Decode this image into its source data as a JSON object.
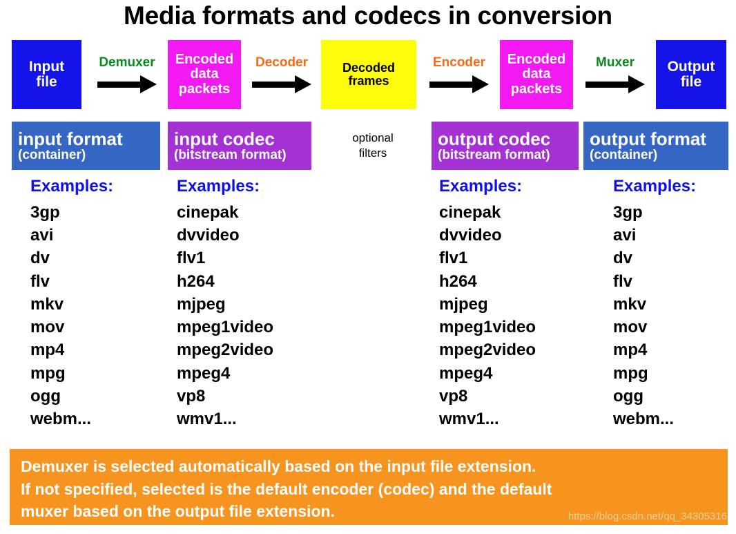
{
  "title": "Media formats and codecs in conversion",
  "pipeline": {
    "boxes": [
      {
        "name": "input-file",
        "lines": [
          "Input",
          "file"
        ],
        "color": "#1414ea"
      },
      {
        "name": "encoded-data-1",
        "lines": [
          "Encoded",
          "data",
          "packets"
        ],
        "color": "#f219f2"
      },
      {
        "name": "decoded-frames",
        "lines": [
          "Decoded",
          "frames"
        ],
        "color": "#fdfd07"
      },
      {
        "name": "encoded-data-2",
        "lines": [
          "Encoded",
          "data",
          "packets"
        ],
        "color": "#f219f2"
      },
      {
        "name": "output-file",
        "lines": [
          "Output",
          "file"
        ],
        "color": "#1414ea"
      }
    ],
    "arrows": [
      {
        "name": "demuxer",
        "label": "Demuxer",
        "color": "#0a8a1e"
      },
      {
        "name": "decoder",
        "label": "Decoder",
        "color": "#f96b16"
      },
      {
        "name": "encoder",
        "label": "Encoder",
        "color": "#f96b16"
      },
      {
        "name": "muxer",
        "label": "Muxer",
        "color": "#0a8a1e"
      }
    ]
  },
  "headers": {
    "input_format": {
      "main": "input format",
      "sub": "(container)",
      "color": "#3566c4"
    },
    "input_codec": {
      "main": "input codec",
      "sub": "(bitstream format)",
      "color": "#a331d3"
    },
    "output_codec": {
      "main": "output codec",
      "sub": "(bitstream format)",
      "color": "#a331d3"
    },
    "output_format": {
      "main": "output format",
      "sub": "(container)",
      "color": "#3566c4"
    }
  },
  "optional_filters": {
    "line1": "optional",
    "line2": "filters"
  },
  "columns": {
    "examples_label": "Examples:",
    "input_format": [
      "3gp",
      "avi",
      "dv",
      "flv",
      "mkv",
      "mov",
      "mp4",
      "mpg",
      "ogg",
      "webm..."
    ],
    "input_codec": [
      "cinepak",
      "dvvideo",
      "flv1",
      "h264",
      "mjpeg",
      "mpeg1video",
      "mpeg2video",
      "mpeg4",
      "vp8",
      "wmv1..."
    ],
    "output_codec": [
      "cinepak",
      "dvvideo",
      "flv1",
      "h264",
      "mjpeg",
      "mpeg1video",
      "mpeg2video",
      "mpeg4",
      "vp8",
      "wmv1..."
    ],
    "output_format": [
      "3gp",
      "avi",
      "dv",
      "flv",
      "mkv",
      "mov",
      "mp4",
      "mpg",
      "ogg",
      "webm..."
    ]
  },
  "footer": {
    "line1": "Demuxer is selected automatically based on the input file extension.",
    "line2": "If not specified, selected is the default encoder (codec) and the default",
    "line3": "muxer based on the output file extension.",
    "watermark": "https://blog.csdn.net/qq_34305316",
    "background": "#f79420"
  }
}
